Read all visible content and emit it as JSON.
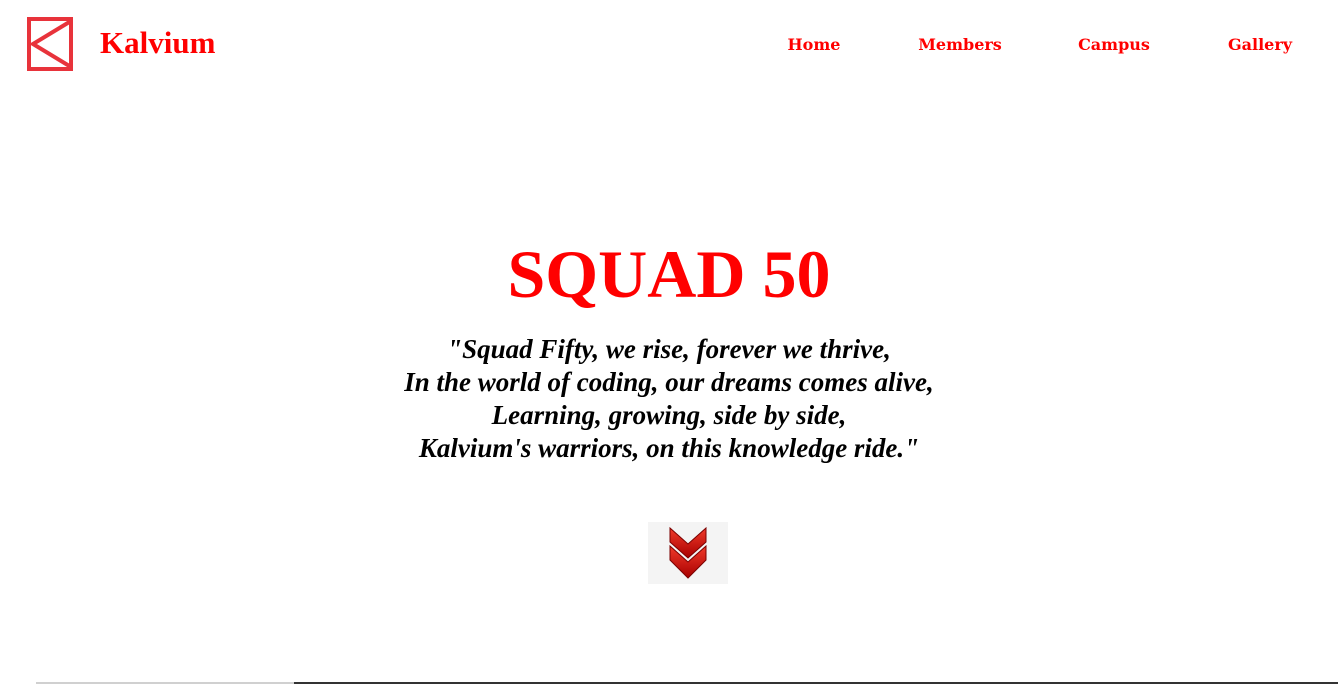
{
  "header": {
    "brand": "Kalvium",
    "logo_icon": "kalvium-logo-icon",
    "nav": [
      {
        "label": "Home"
      },
      {
        "label": "Members"
      },
      {
        "label": "Campus"
      },
      {
        "label": "Gallery"
      }
    ]
  },
  "hero": {
    "title": "SQUAD 50",
    "poem": [
      "\"Squad Fifty, we rise, forever we thrive,",
      "In the world of coding, our dreams comes alive,",
      "Learning, growing, side by side,",
      "Kalvium's warriors, on this knowledge ride.\""
    ],
    "scroll_icon": "double-chevron-down-icon"
  },
  "colors": {
    "accent": "#ff0000",
    "logo": "#e8333b",
    "text": "#000000",
    "background": "#ffffff"
  }
}
